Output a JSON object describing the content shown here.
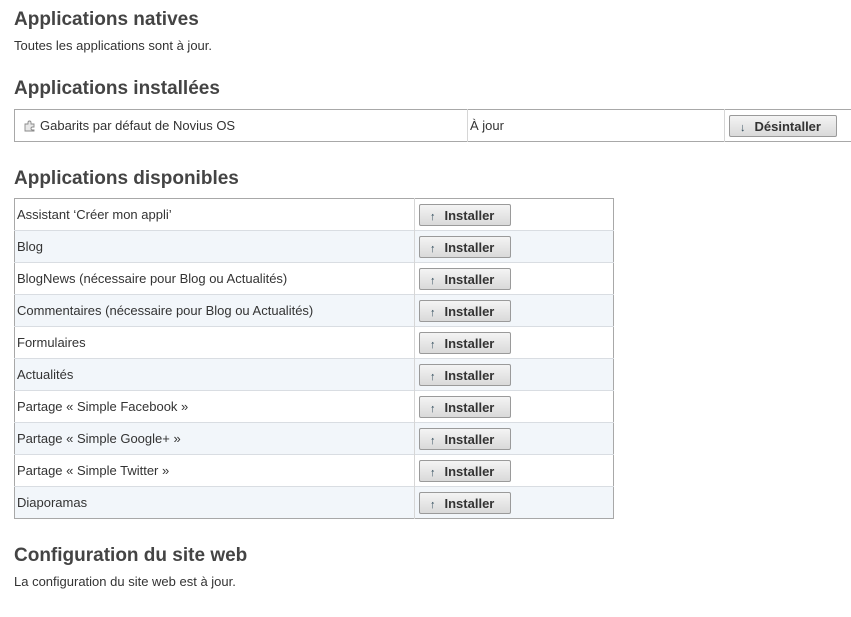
{
  "native": {
    "title": "Applications natives",
    "status": "Toutes les applications sont à jour."
  },
  "installed": {
    "title": "Applications installées",
    "rows": [
      {
        "icon": "puzzle-icon",
        "name": "Gabarits par défaut de Novius OS",
        "status": "À jour",
        "action_label": "Désintaller",
        "action_icon": "↓"
      }
    ]
  },
  "available": {
    "title": "Applications disponibles",
    "install_label": "Installer",
    "install_icon": "↑",
    "rows": [
      {
        "name": "Assistant ‘Créer mon appli’"
      },
      {
        "name": "Blog"
      },
      {
        "name": "BlogNews (nécessaire pour Blog ou Actualités)"
      },
      {
        "name": "Commentaires (nécessaire pour Blog ou Actualités)"
      },
      {
        "name": "Formulaires"
      },
      {
        "name": "Actualités"
      },
      {
        "name": "Partage « Simple Facebook »"
      },
      {
        "name": "Partage « Simple Google+ »"
      },
      {
        "name": "Partage « Simple Twitter »"
      },
      {
        "name": "Diaporamas"
      }
    ]
  },
  "config": {
    "title": "Configuration du site web",
    "status": "La configuration du site web est à jour."
  }
}
